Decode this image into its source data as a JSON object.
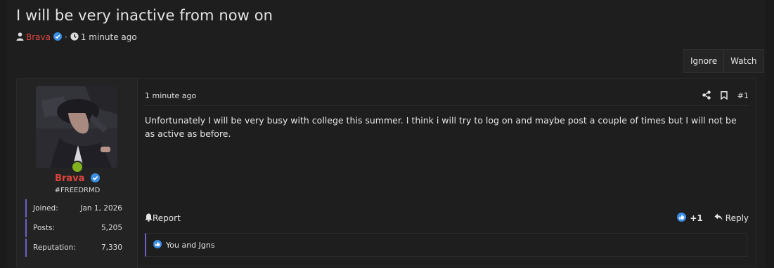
{
  "thread": {
    "title": "I will be very inactive from now on",
    "author": "Brava",
    "separator": "·",
    "time_ago": "1 minute ago",
    "actions": {
      "ignore_label": "Ignore",
      "watch_label": "Watch"
    }
  },
  "post": {
    "date": "1 minute ago",
    "number": "#1",
    "body": "Unfortunately I will be very busy with college this summer. I think i will try to log on and maybe post a couple of times but I will not be as active as before.",
    "report_label": "Report",
    "reaction_count": "+1",
    "reply_label": "Reply",
    "reactions_text": "You and Jgns"
  },
  "user": {
    "name": "Brava",
    "title": "#FREEDRMD",
    "stats": [
      {
        "label": "Joined:",
        "value": "Jan 1, 2026"
      },
      {
        "label": "Posts:",
        "value": "5,205"
      },
      {
        "label": "Reputation:",
        "value": "7,330"
      }
    ]
  },
  "colors": {
    "username": "#e0453e",
    "verified": "#3a8ee6",
    "online": "#7fb21c",
    "accent_bar": "#6b61c9"
  },
  "icons": [
    "user-icon",
    "verified-icon",
    "clock-icon",
    "share-icon",
    "bookmark-icon",
    "bell-icon",
    "like-icon",
    "reply-icon"
  ]
}
